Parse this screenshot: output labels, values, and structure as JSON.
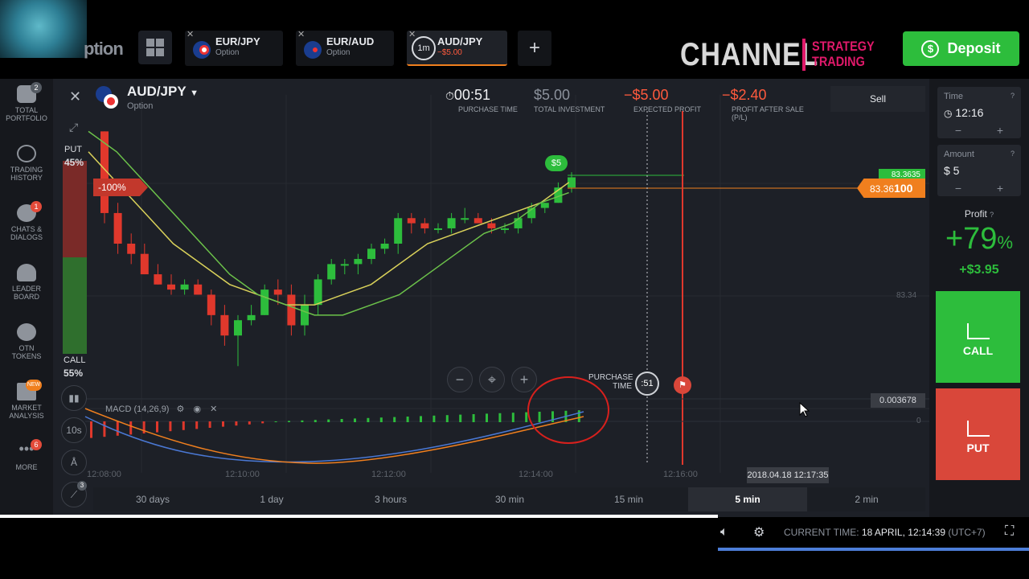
{
  "header": {
    "logo_word": "ption",
    "tabs": [
      {
        "name": "EUR/JPY",
        "sub": "Option"
      },
      {
        "name": "EUR/AUD",
        "sub": "Option"
      },
      {
        "name": "AUD/JPY",
        "sub": "−$5.00",
        "timer": "1m",
        "active": true
      }
    ],
    "add_tab": "+",
    "channel": "CHANNEL",
    "strategy_l1": "STRATEGY",
    "strategy_l2": "TRADING",
    "deposit": "Deposit"
  },
  "sidebar": {
    "items": [
      {
        "label1": "TOTAL",
        "label2": "PORTFOLIO",
        "badge": "2",
        "icon": "briefcase-icon"
      },
      {
        "label1": "TRADING",
        "label2": "HISTORY",
        "badge": "",
        "icon": "history-icon"
      },
      {
        "label1": "CHATS &",
        "label2": "DIALOGS",
        "badge": "1",
        "icon": "chat-icon"
      },
      {
        "label1": "LEADER",
        "label2": "BOARD",
        "badge": "",
        "icon": "trophy-icon"
      },
      {
        "label1": "OTN",
        "label2": "TOKENS",
        "badge": "",
        "icon": "token-icon"
      },
      {
        "label1": "MARKET",
        "label2": "ANALYSIS",
        "badge": "NEW",
        "icon": "market-analysis-icon"
      },
      {
        "label1": "MORE",
        "label2": "",
        "badge": "6",
        "icon": "more-icon"
      }
    ]
  },
  "asset": {
    "name": "AUD/JPY",
    "sub": "Option"
  },
  "sentiment": {
    "put_label": "PUT",
    "put_pct": "45%",
    "call_label": "CALL",
    "call_pct": "55%"
  },
  "position_tag": "-100%",
  "stats": {
    "purchase_time": "00:51",
    "purchase_time_lbl": "PURCHASE TIME",
    "total_investment": "$5.00",
    "total_investment_lbl": "TOTAL INVESTMENT",
    "expected_profit": "−$5.00",
    "expected_profit_lbl": "EXPECTED PROFIT",
    "profit_after_sale": "−$2.40",
    "profit_after_sale_lbl1": "PROFIT AFTER SALE",
    "profit_after_sale_lbl2": "(P/L)",
    "sell": "Sell"
  },
  "prices": {
    "current_green": "83.3635",
    "current_orange": "83.36",
    "current_orange_bold": "100",
    "axis": "83.34",
    "deal_tag": "$5"
  },
  "purchase": {
    "label1": "PURCHASE",
    "label2": "TIME",
    "timer": ":51"
  },
  "macd": {
    "label": "MACD (14,26,9)",
    "value": "0.003678",
    "zero": "0"
  },
  "tools": {
    "interval": "10s",
    "drawing_badge": "3"
  },
  "xaxis": [
    "12:08:00",
    "12:10:00",
    "12:12:00",
    "12:14:00",
    "12:16:00"
  ],
  "date_tip": "2018.04.18 12:17:35",
  "periods": [
    "30 days",
    "1 day",
    "3 hours",
    "30 min",
    "15 min",
    "5 min",
    "2 min"
  ],
  "active_period": "5 min",
  "right": {
    "time_lbl": "Time",
    "time_val": "12:16",
    "amount_lbl": "Amount",
    "amount_val": "$ 5",
    "minus": "−",
    "plus": "+",
    "profit_lbl": "Profit",
    "profit_pct": "+79",
    "profit_pct_sign": "%",
    "profit_amt": "+$3.95",
    "call": "CALL",
    "put": "PUT"
  },
  "footer": {
    "current_time_lbl": "CURRENT TIME:",
    "current_time": "18 APRIL, 12:14:39",
    "tz": "(UTC+7)"
  },
  "colors": {
    "green": "#2dbd3c",
    "red": "#d9473a",
    "orange": "#f07f1e",
    "bg": "#1d2027"
  },
  "chart_data": {
    "type": "candlestick",
    "candles": [
      [
        83.36,
        83.36,
        83.27,
        83.28
      ],
      [
        83.28,
        83.29,
        83.24,
        83.25
      ],
      [
        83.25,
        83.26,
        83.23,
        83.24
      ],
      [
        83.24,
        83.25,
        83.22,
        83.22
      ],
      [
        83.22,
        83.23,
        83.21,
        83.21
      ],
      [
        83.21,
        83.22,
        83.2,
        83.205
      ],
      [
        83.205,
        83.215,
        83.2,
        83.21
      ],
      [
        83.21,
        83.215,
        83.2,
        83.2
      ],
      [
        83.2,
        83.205,
        83.17,
        83.18
      ],
      [
        83.18,
        83.19,
        83.15,
        83.16
      ],
      [
        83.16,
        83.18,
        83.13,
        83.175
      ],
      [
        83.175,
        83.19,
        83.17,
        83.18
      ],
      [
        83.18,
        83.21,
        83.18,
        83.205
      ],
      [
        83.205,
        83.215,
        83.19,
        83.2
      ],
      [
        83.2,
        83.21,
        83.16,
        83.17
      ],
      [
        83.17,
        83.2,
        83.16,
        83.19
      ],
      [
        83.19,
        83.22,
        83.18,
        83.215
      ],
      [
        83.215,
        83.235,
        83.21,
        83.23
      ],
      [
        83.23,
        83.235,
        83.22,
        83.23
      ],
      [
        83.23,
        83.24,
        83.22,
        83.235
      ],
      [
        83.235,
        83.25,
        83.23,
        83.245
      ],
      [
        83.245,
        83.255,
        83.24,
        83.25
      ],
      [
        83.25,
        83.28,
        83.24,
        83.275
      ],
      [
        83.275,
        83.28,
        83.26,
        83.27
      ],
      [
        83.27,
        83.275,
        83.26,
        83.265
      ],
      [
        83.265,
        83.27,
        83.26,
        83.265
      ],
      [
        83.265,
        83.28,
        83.26,
        83.275
      ],
      [
        83.275,
        83.285,
        83.27,
        83.275
      ],
      [
        83.275,
        83.28,
        83.27,
        83.27
      ],
      [
        83.27,
        83.275,
        83.26,
        83.265
      ],
      [
        83.265,
        83.27,
        83.26,
        83.265
      ],
      [
        83.265,
        83.28,
        83.26,
        83.275
      ],
      [
        83.275,
        83.29,
        83.27,
        83.285
      ],
      [
        83.285,
        83.29,
        83.28,
        83.29
      ],
      [
        83.29,
        83.31,
        83.29,
        83.305
      ],
      [
        83.305,
        83.32,
        83.3,
        83.315
      ]
    ],
    "ma_fast": [
      83.34,
      83.31,
      83.28,
      83.25,
      83.23,
      83.21,
      83.2,
      83.19,
      83.19,
      83.2,
      83.21,
      83.23,
      83.25,
      83.26,
      83.27,
      83.28,
      83.29,
      83.31
    ],
    "ma_slow": [
      83.36,
      83.34,
      83.31,
      83.28,
      83.25,
      83.22,
      83.2,
      83.19,
      83.18,
      83.18,
      83.19,
      83.2,
      83.22,
      83.24,
      83.26,
      83.27,
      83.29,
      83.3
    ]
  }
}
